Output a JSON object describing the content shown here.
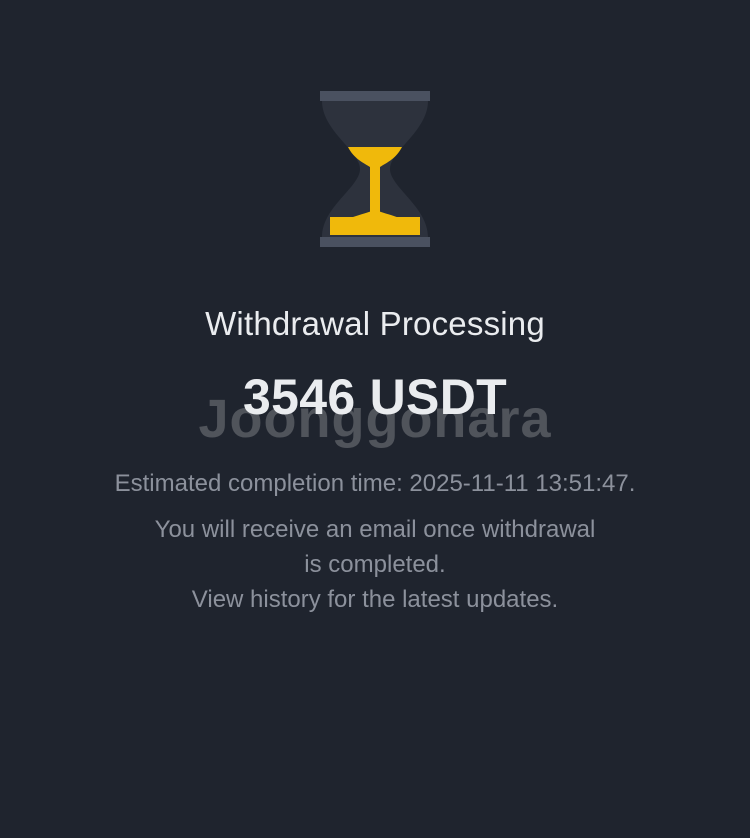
{
  "status": {
    "icon": "hourglass-icon",
    "title": "Withdrawal Processing",
    "amount": "3546 USDT",
    "eta": "Estimated completion time: 2025-11-11 13:51:47.",
    "message_lines": [
      "You will receive an email once withdrawal",
      "is completed.",
      "View history for the latest updates."
    ]
  },
  "watermark": {
    "text": "Joonggonara"
  },
  "colors": {
    "background": "#1f242e",
    "hourglass_frame": "#4a5160",
    "hourglass_glass": "#2d323d",
    "hourglass_sand": "#f0b90b",
    "title_text": "#eaecef",
    "secondary_text": "#8c919c"
  }
}
